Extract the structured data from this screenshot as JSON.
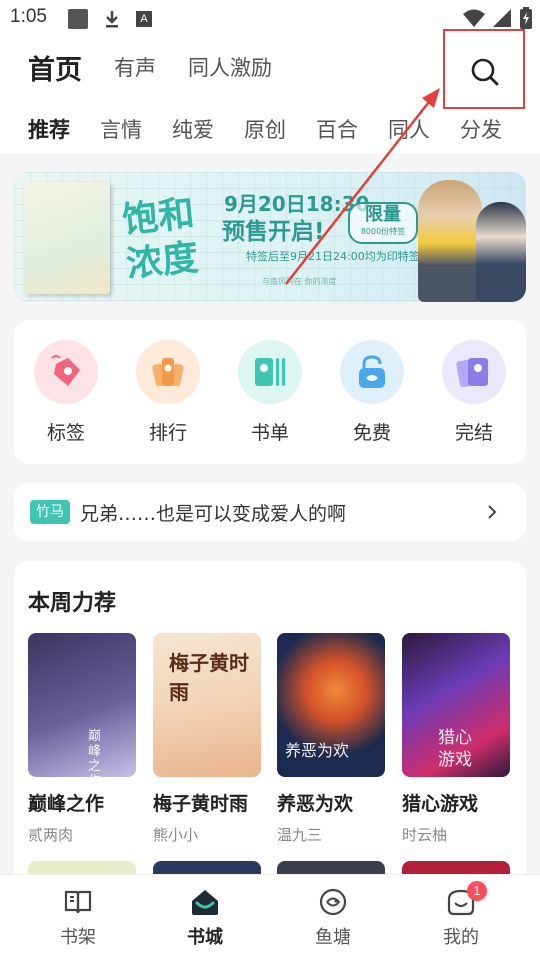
{
  "status_bar": {
    "time": "1:05",
    "left_icons": [
      "square-icon",
      "download-icon",
      "a-letter-icon"
    ],
    "right_icons": [
      "wifi-icon",
      "signal-icon",
      "battery-icon"
    ]
  },
  "header": {
    "main_tabs": [
      {
        "label": "首页",
        "active": true
      },
      {
        "label": "有声",
        "active": false
      },
      {
        "label": "同人激励",
        "active": false
      }
    ],
    "search_icon": "search-icon",
    "sub_tabs": [
      {
        "label": "推荐",
        "active": true
      },
      {
        "label": "言情",
        "active": false
      },
      {
        "label": "纯爱",
        "active": false
      },
      {
        "label": "原创",
        "active": false
      },
      {
        "label": "百合",
        "active": false
      },
      {
        "label": "同人",
        "active": false
      },
      {
        "label": "分发",
        "active": false
      }
    ]
  },
  "banner": {
    "title_line1": "饱和",
    "title_line2": "浓度",
    "date": "9月20日18:30",
    "presale": "预售开启!",
    "limit": "限量",
    "limit_note": "8000份特签",
    "note": "特签后至9月21日24:00均为印特签",
    "sub_note": "与南风同在 你的浓度"
  },
  "shortcuts": [
    {
      "label": "标签",
      "icon": "tag-icon",
      "color": "#fde3e6",
      "accent": "#f0657b"
    },
    {
      "label": "排行",
      "icon": "ranking-icon",
      "color": "#fdeadb",
      "accent": "#f09a4a"
    },
    {
      "label": "书单",
      "icon": "booklist-icon",
      "color": "#ddf6f2",
      "accent": "#3ec6b2"
    },
    {
      "label": "免费",
      "icon": "unlock-icon",
      "color": "#e0f0fb",
      "accent": "#4aa8e8"
    },
    {
      "label": "完结",
      "icon": "finished-icon",
      "color": "#ebe8fb",
      "accent": "#8a7de8"
    }
  ],
  "notice": {
    "tag": "竹马",
    "text": "兄弟……也是可以变成爱人的啊"
  },
  "weekly": {
    "title": "本周力荐",
    "books": [
      {
        "name": "巅峰之作",
        "author": "贰两肉",
        "cover_text": "巅峰之作",
        "colors": [
          "#3a3560",
          "#6b5f9a",
          "#c8c0e8"
        ]
      },
      {
        "name": "梅子黄时雨",
        "author": "熊小小",
        "cover_text": "梅子黄时雨",
        "colors": [
          "#f2d3b8",
          "#e9b48d",
          "#f6e6d4"
        ]
      },
      {
        "name": "养恶为欢",
        "author": "温九三",
        "cover_text": "养恶为欢",
        "colors": [
          "#1b2a4e",
          "#d4522a",
          "#f08a3c"
        ]
      },
      {
        "name": "猎心游戏",
        "author": "时云柚",
        "cover_text": "猎心游戏",
        "colors": [
          "#2a1b3a",
          "#d02d6a",
          "#6a3bb5"
        ]
      }
    ],
    "next_row_colors": [
      "#e6efc9",
      "#2b3a5c",
      "#3a3f4a",
      "#b3203a"
    ]
  },
  "bottom_nav": [
    {
      "label": "书架",
      "icon": "bookshelf-icon",
      "active": false
    },
    {
      "label": "书城",
      "icon": "bookstore-icon",
      "active": true
    },
    {
      "label": "鱼塘",
      "icon": "fishpond-icon",
      "active": false
    },
    {
      "label": "我的",
      "icon": "profile-icon",
      "active": false,
      "badge": "1"
    }
  ],
  "colors": {
    "accent": "#3ec6b2",
    "annotation": "#e2403b",
    "badge": "#ff4d5e"
  }
}
